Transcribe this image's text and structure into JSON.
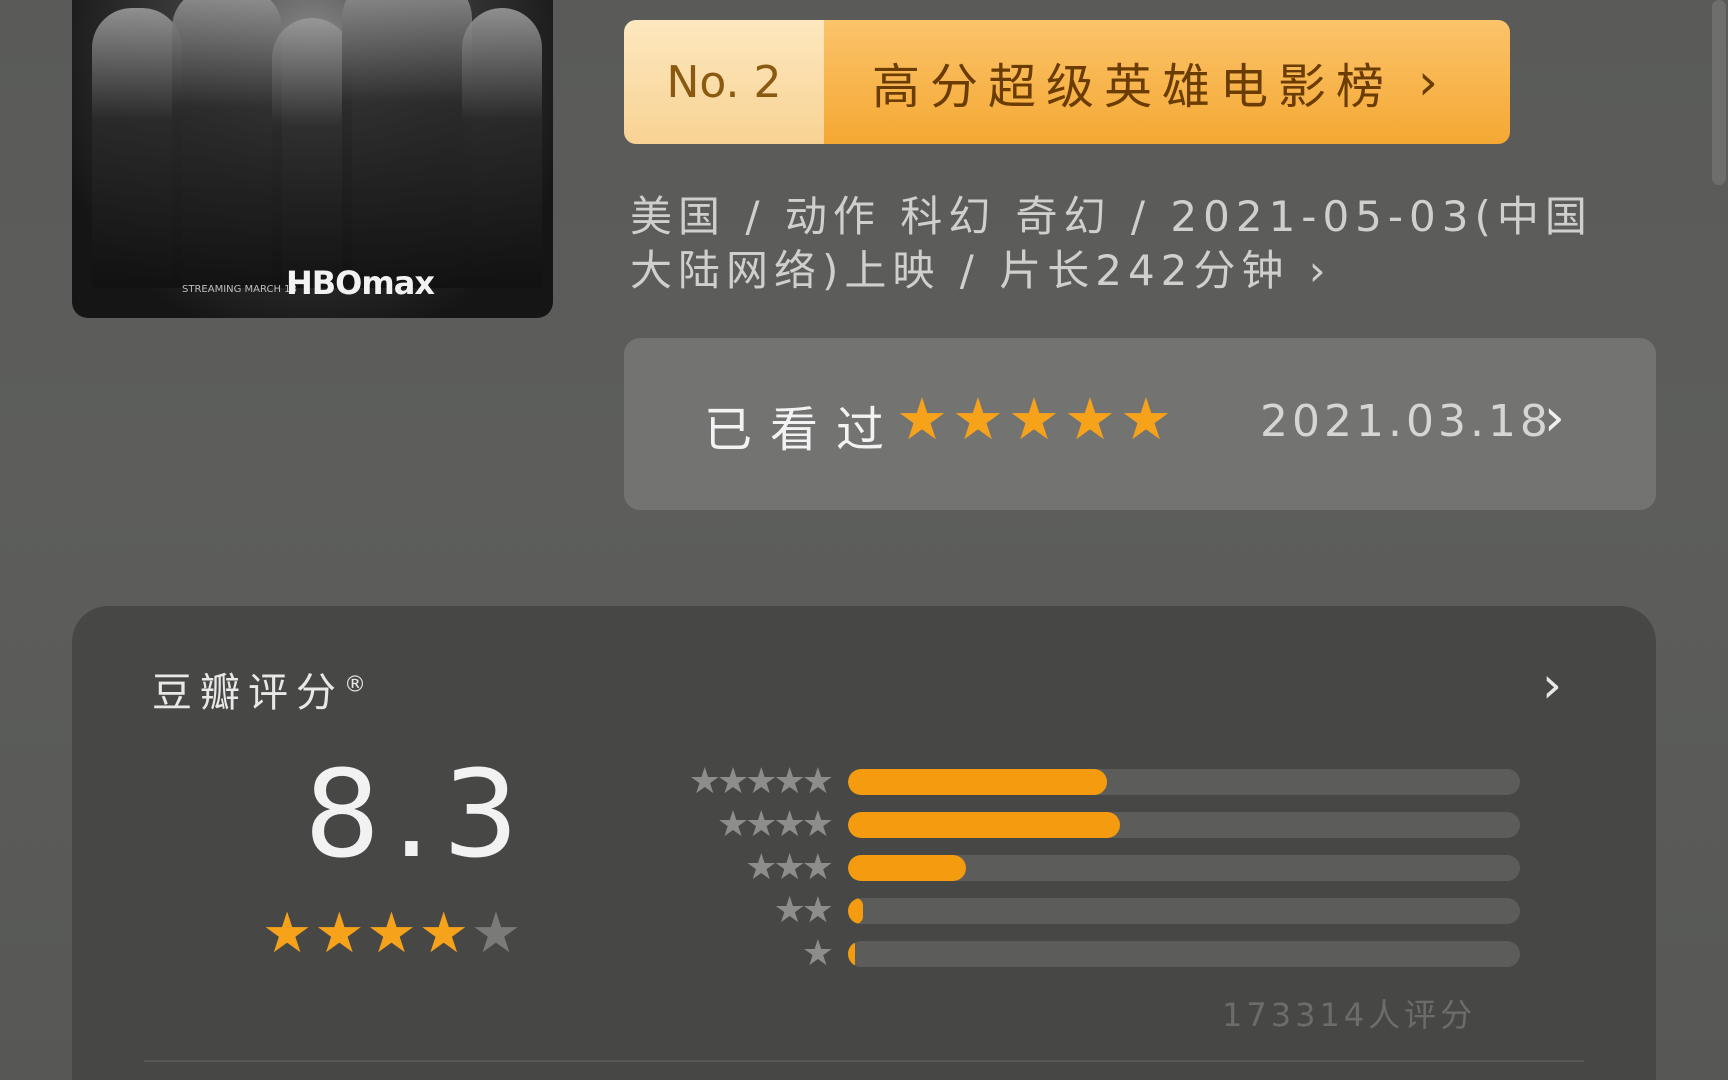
{
  "poster": {
    "tagline": "STREAMING MARCH 18",
    "logo": "HBOmax"
  },
  "rank": {
    "number": "No. 2",
    "list_title": "高分超级英雄电影榜",
    "chevron": "›"
  },
  "meta": {
    "info": "美国 / 动作 科幻 奇幻 / 2021-05-03(中国大陆网络)上映 / 片长242分钟 ›"
  },
  "watched": {
    "label": "已看过",
    "user_rating": 5,
    "date": "2021.03.18",
    "chevron": "›"
  },
  "douban_rating": {
    "title": "豆瓣评分",
    "registered": "®",
    "chevron": "›",
    "score": "8.3",
    "score_stars": 4,
    "distribution": [
      {
        "stars": 5,
        "percent": 38.5
      },
      {
        "stars": 4,
        "percent": 40.5
      },
      {
        "stars": 3,
        "percent": 17.5
      },
      {
        "stars": 2,
        "percent": 2.3
      },
      {
        "stars": 1,
        "percent": 1.0
      }
    ],
    "count_text": "173314人评分"
  },
  "colors": {
    "accent": "#f59b0f",
    "star_on": "#f6a21a",
    "star_off": "#7a7b79"
  }
}
